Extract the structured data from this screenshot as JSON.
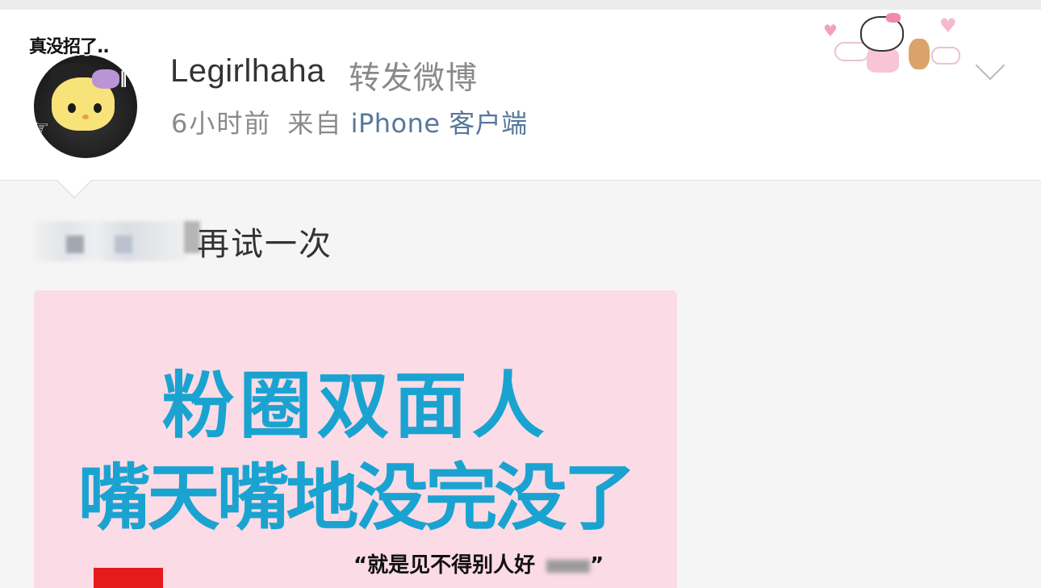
{
  "post": {
    "username": "Legirlhaha",
    "action": "转发微博",
    "time": "6小时前",
    "from_label": "来自",
    "client": "iPhone 客户端",
    "avatar_caption": "真没招了..",
    "repost_text": "再试一次"
  },
  "image": {
    "headline_line1": "粉圈双面人",
    "headline_line2": "嘴天嘴地没完没了",
    "quote": "“就是见不得别人好",
    "quote_end": "”"
  },
  "icons": {
    "expand": "chevron-down-icon",
    "sticker": "hello-kitty-sticker-icon"
  },
  "colors": {
    "link_blue": "#56789a",
    "headline_blue": "#1aa3d1",
    "image_bg": "#fbdbe6"
  }
}
